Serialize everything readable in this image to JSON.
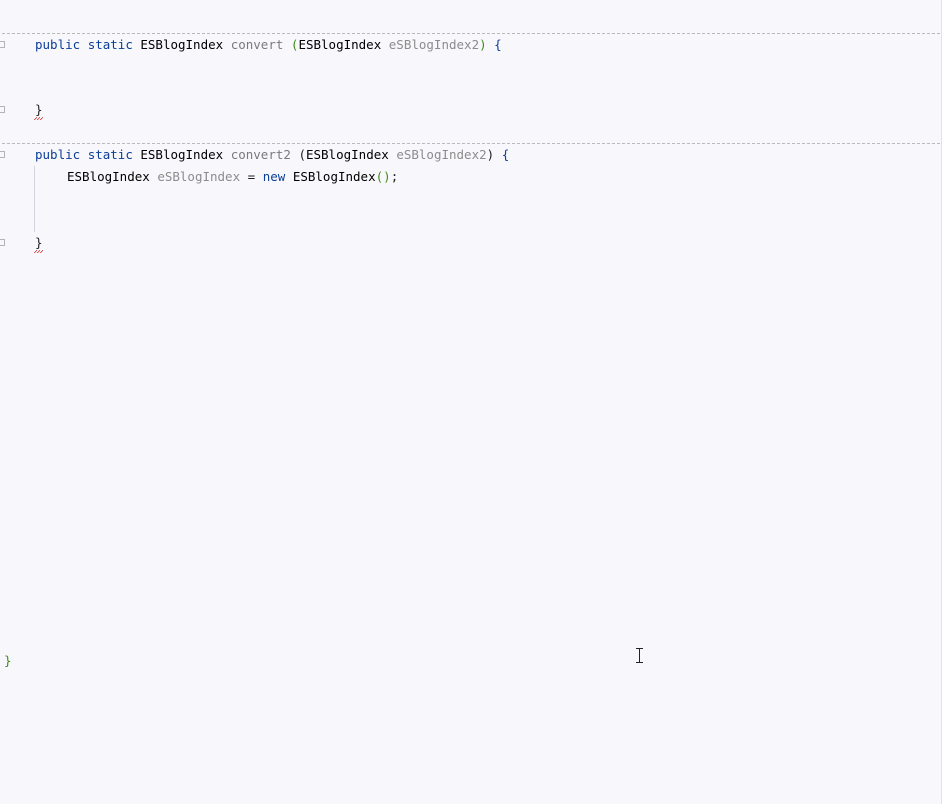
{
  "editor": {
    "method1": {
      "signature": {
        "kw_public": "public",
        "kw_static": "static",
        "return_type": "ESBlogIndex",
        "name": "convert",
        "open_paren": "(",
        "param_type": "ESBlogIndex",
        "param_name": "eSBlogIndex2",
        "close_paren": ")",
        "open_brace": "{"
      },
      "close_brace": "}"
    },
    "method2": {
      "signature": {
        "kw_public": "public",
        "kw_static": "static",
        "return_type": "ESBlogIndex",
        "name": "convert2",
        "open_paren": "(",
        "param_type": "ESBlogIndex",
        "param_name": "eSBlogIndex2",
        "close_paren": ")",
        "open_brace": "{"
      },
      "body": {
        "var_type": "ESBlogIndex",
        "var_name": "eSBlogIndex",
        "assign": "=",
        "kw_new": "new",
        "ctor_type": "ESBlogIndex",
        "ctor_parens": "()",
        "semicolon": ";"
      },
      "close_brace": "}"
    },
    "class_close_brace": "}"
  },
  "colors": {
    "background": "#f8f8fc",
    "keyword": "#0b3e99",
    "method_name": "#7a7a7a",
    "parameter": "#8c8c8c",
    "paren_match": "#3f8f16",
    "error_squiggle": "#d42020"
  },
  "icons": [
    "fold-marker-icon",
    "text-cursor-icon"
  ]
}
